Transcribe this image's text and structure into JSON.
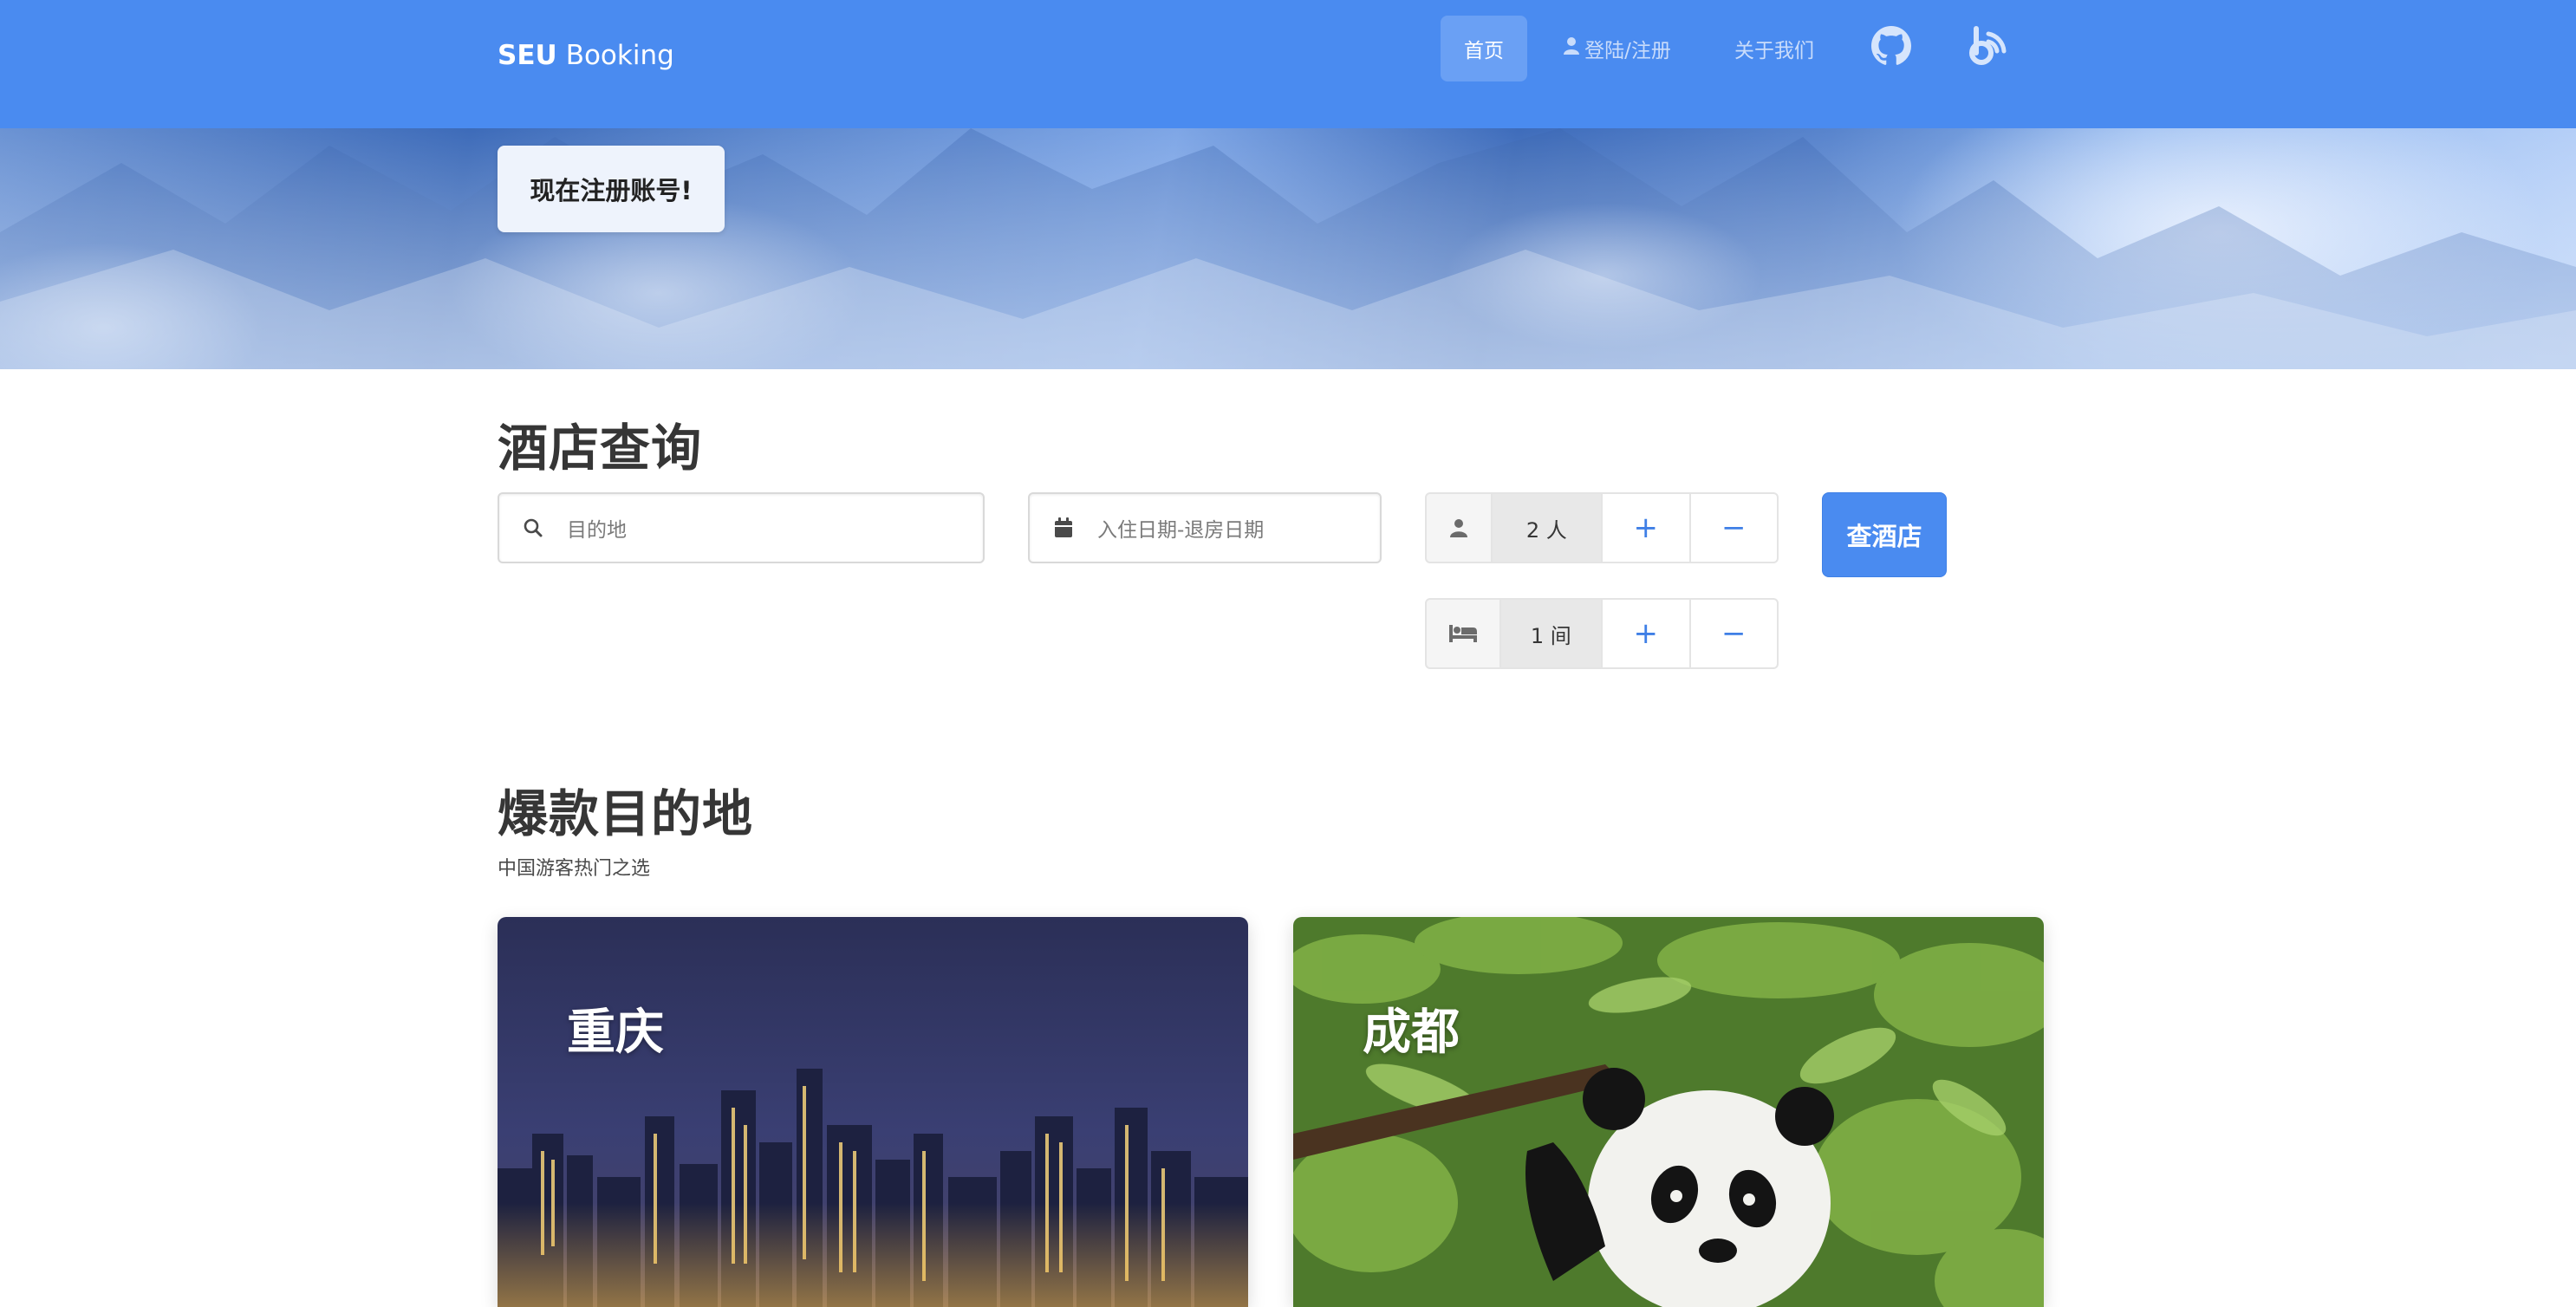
{
  "navbar": {
    "brand_strong": "SEU",
    "brand_rest": "Booking",
    "items": [
      {
        "label": "首页"
      },
      {
        "label": "登陆/注册"
      },
      {
        "label": "关于我们"
      }
    ],
    "icons": [
      "github-icon",
      "blog-icon"
    ],
    "colors": {
      "navbar": "#4a8bf0",
      "active_item": "#6aa0f4"
    }
  },
  "hero": {
    "register_label": "现在注册账号!"
  },
  "search": {
    "title": "酒店查询",
    "destination_placeholder": "目的地",
    "dates_placeholder": "入住日期-退房日期",
    "guests_value": "2 人",
    "rooms_value": "1 间",
    "plus": "+",
    "minus": "−",
    "submit_label": "查酒店"
  },
  "destinations": {
    "title": "爆款目的地",
    "subtitle": "中国游客热门之选",
    "cards": [
      {
        "name": "重庆"
      },
      {
        "name": "成都"
      }
    ]
  }
}
